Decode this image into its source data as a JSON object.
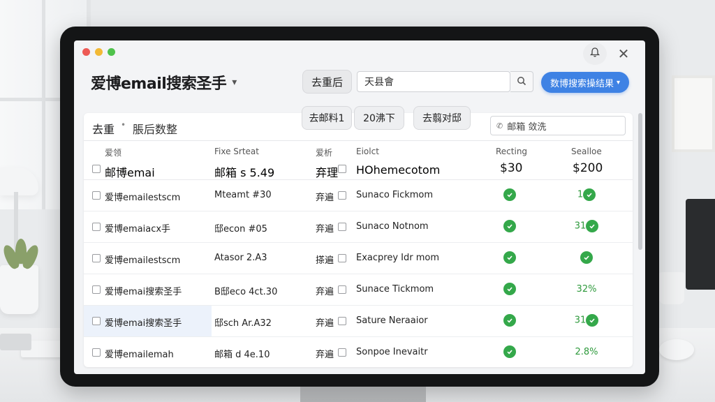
{
  "app": {
    "title": "爱博email搜索圣手"
  },
  "toolbar": {
    "dedupe_label": "去重后",
    "search_value": "天县會",
    "primary_label": "数博搜索操结果"
  },
  "subtoolbar": {
    "crumb_main": "去重",
    "crumb_sep": "•",
    "crumb_sub": "脹后数整",
    "btn_email1": "去邮料1",
    "btn_20": "20沸下",
    "btn_fetch": "去翦对邸",
    "filter_placeholder": "邮箱 敛洗"
  },
  "table": {
    "headers": [
      "爱领",
      "Fixe Srteat",
      "爱析",
      "Eiolct",
      "Recting",
      "Sealloe"
    ],
    "first_row": {
      "c1": "邮博emai",
      "c2": "邮箱 s 5.49",
      "c3": "弃理",
      "c4": "HOhemecotom",
      "c5": "$30",
      "c6": "$200"
    },
    "rows": [
      {
        "c1": "爱博emailestscm",
        "c2": "Mteamt #30",
        "c3": "弃遍",
        "c4": "Sunaco Fickmom",
        "c6": "1"
      },
      {
        "c1": "爱博emaiacx手",
        "c2": "邸econ #05",
        "c3": "弃遍",
        "c4": "Sunaco Notnom",
        "c6": "31"
      },
      {
        "c1": "爱博emailestscm",
        "c2": "Atasor 2.A3",
        "c3": "搽遍",
        "c4": "Exacprey Idr mom",
        "c6": ""
      },
      {
        "c1": "爱博emai搜索圣手",
        "c2": "B邸eco 4ct.30",
        "c3": "弃遍",
        "c4": "Sunace Tickmom",
        "c6": "32%"
      },
      {
        "c1": "爱博emai搜索圣手",
        "c2": "邸sch Ar.A32",
        "c3": "弃遍",
        "c4": "Sature Neraaior",
        "c6": "31"
      },
      {
        "c1": "爱博emailemah",
        "c2": "邮箱 d 4e.10",
        "c3": "弃遍",
        "c4": "Sonpoe Inevaitr",
        "c6": "2.8%"
      }
    ]
  },
  "colors": {
    "accent": "#3e82e4",
    "success": "#34a84a"
  }
}
